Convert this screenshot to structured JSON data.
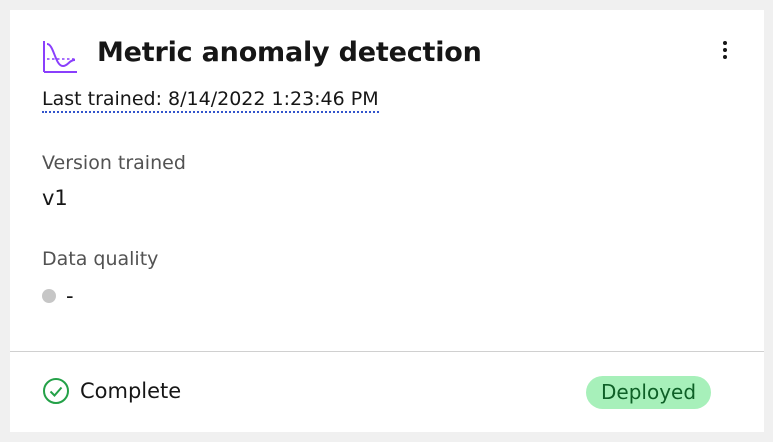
{
  "card": {
    "title": "Metric anomaly detection",
    "title_icon": "line-chart-icon",
    "menu_icon": "overflow-menu-vertical-icon",
    "last_trained": "Last trained: 8/14/2022 1:23:46 PM",
    "version": {
      "label": "Version trained",
      "value": "v1"
    },
    "data_quality": {
      "label": "Data quality",
      "value": "-",
      "indicator_color": "#c6c6c6"
    },
    "footer": {
      "status_icon": "checkmark-outline-icon",
      "status_label": "Complete",
      "status_color": "#24a148",
      "badge": "Deployed",
      "badge_color": "#a7f0ba"
    }
  }
}
